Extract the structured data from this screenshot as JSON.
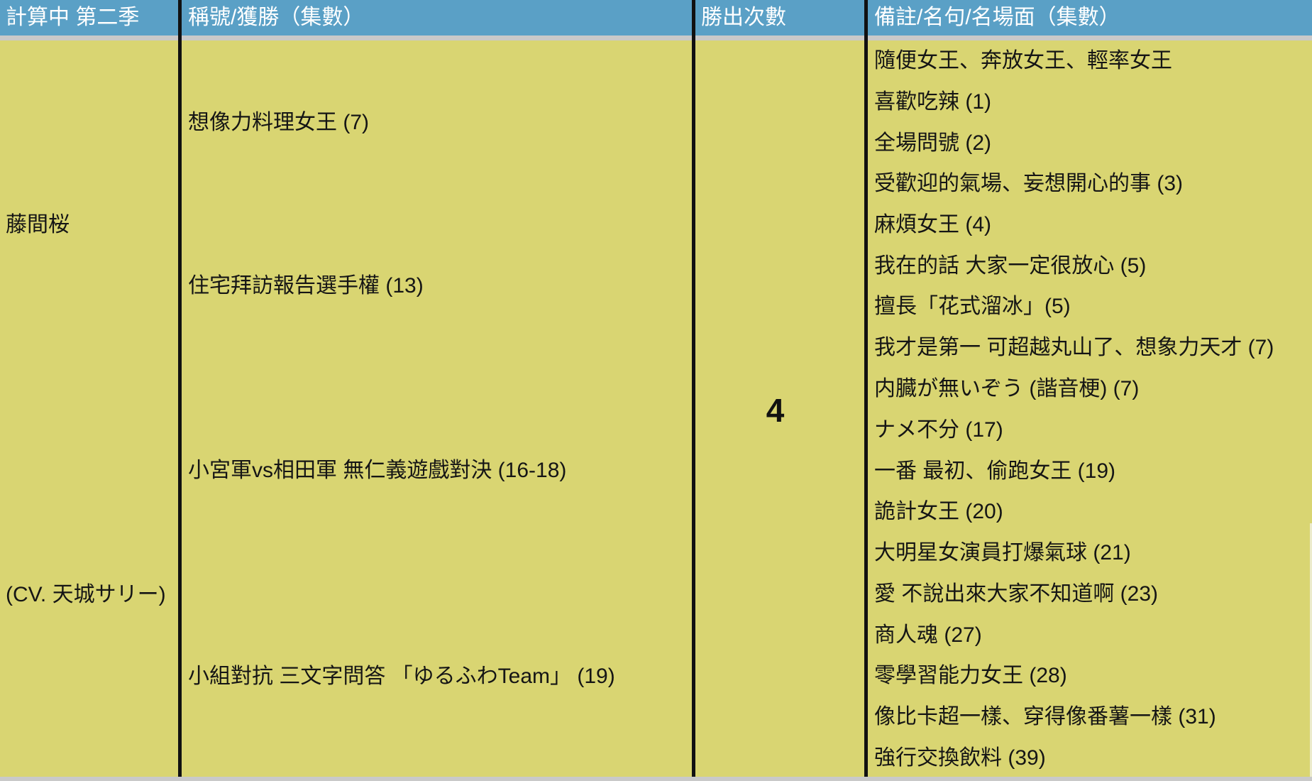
{
  "table": {
    "headers": {
      "character": "計算中 第二季",
      "titles": "稱號/獲勝（集數）",
      "wins": "勝出次數",
      "notes": "備註/名句/名場面（集數）"
    },
    "row": {
      "name": "藤間桜",
      "cv": "(CV. 天城サリー)",
      "titles": [
        "想像力料理女王 (7)",
        "住宅拜訪報告選手權 (13)",
        "小宮軍vs相田軍 無仁義遊戲對決 (16-18)",
        "小組對抗 三文字問答 「ゆるふわTeam」 (19)"
      ],
      "wins": "4",
      "notes": [
        "隨便女王、奔放女王、輕率女王",
        "喜歡吃辣 (1)",
        "全場問號 (2)",
        "受歡迎的氣場、妄想開心的事 (3)",
        "麻煩女王 (4)",
        "我在的話 大家一定很放心 (5)",
        "擅長「花式溜冰」(5)",
        "我才是第一 可超越丸山了、想象力天才 (7)",
        "内臓が無いぞう (諧音梗) (7)",
        "ナメ不分 (17)",
        "一番 最初、偷跑女王 (19)",
        "詭計女王 (20)",
        "大明星女演員打爆氣球 (21)",
        "愛 不說出來大家不知道啊 (23)",
        "商人魂 (27)",
        "零學習能力女王 (28)",
        "像比卡超一樣、穿得像番薯一樣 (31)",
        "強行交換飲料 (39)"
      ]
    }
  },
  "colors": {
    "header_bg": "#5aa0c6",
    "body_bg": "#d9d572",
    "grid_line": "#111111"
  }
}
